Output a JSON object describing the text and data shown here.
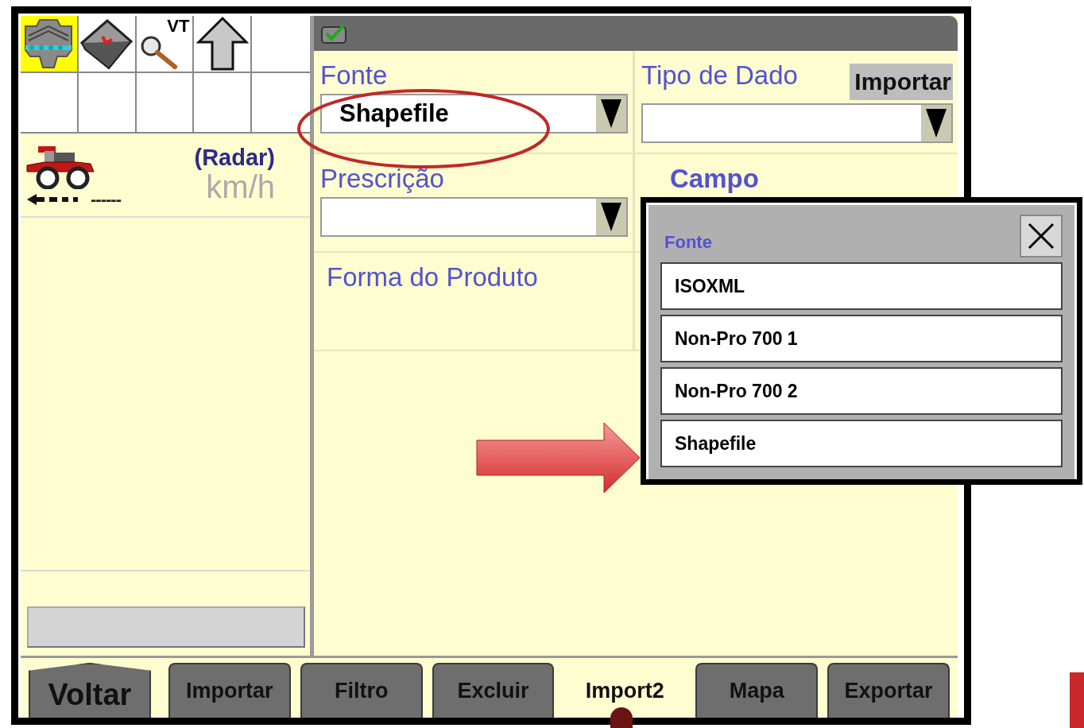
{
  "toolbar": {
    "cells": [
      {
        "kind": "boom",
        "selected": true
      },
      {
        "kind": "book",
        "selected": false
      },
      {
        "kind": "vt-search",
        "label": "VT",
        "selected": false
      },
      {
        "kind": "up-arrow",
        "selected": false
      }
    ]
  },
  "speed": {
    "source": "(Radar)",
    "value": "------",
    "unit": "km/h"
  },
  "header": {
    "checked": true
  },
  "form": {
    "import_button": "Importar",
    "fields": [
      {
        "kind": "dropdown",
        "label": "Fonte",
        "value": "Shapefile"
      },
      {
        "kind": "dropdown",
        "label": "Tipo de Dado"
      },
      {
        "kind": "dropdown",
        "label": "Prescrição"
      },
      {
        "kind": "label",
        "label": "Campo"
      },
      {
        "kind": "label",
        "label": "Forma do Produto"
      }
    ]
  },
  "popup": {
    "title": "Fonte",
    "options": [
      "ISOXML",
      "Non-Pro 700 1",
      "Non-Pro 700 2",
      "Shapefile"
    ]
  },
  "tabs": [
    {
      "kind": "back",
      "label": "Voltar",
      "selected": false
    },
    {
      "kind": "tab",
      "label": "Importar",
      "selected": false
    },
    {
      "kind": "tab",
      "label": "Filtro",
      "selected": false
    },
    {
      "kind": "tab",
      "label": "Excluir",
      "selected": false
    },
    {
      "kind": "tab",
      "label": "Import2",
      "selected": true
    },
    {
      "kind": "tab",
      "label": "Mapa",
      "selected": false
    },
    {
      "kind": "tab",
      "label": "Exportar",
      "selected": false
    }
  ]
}
